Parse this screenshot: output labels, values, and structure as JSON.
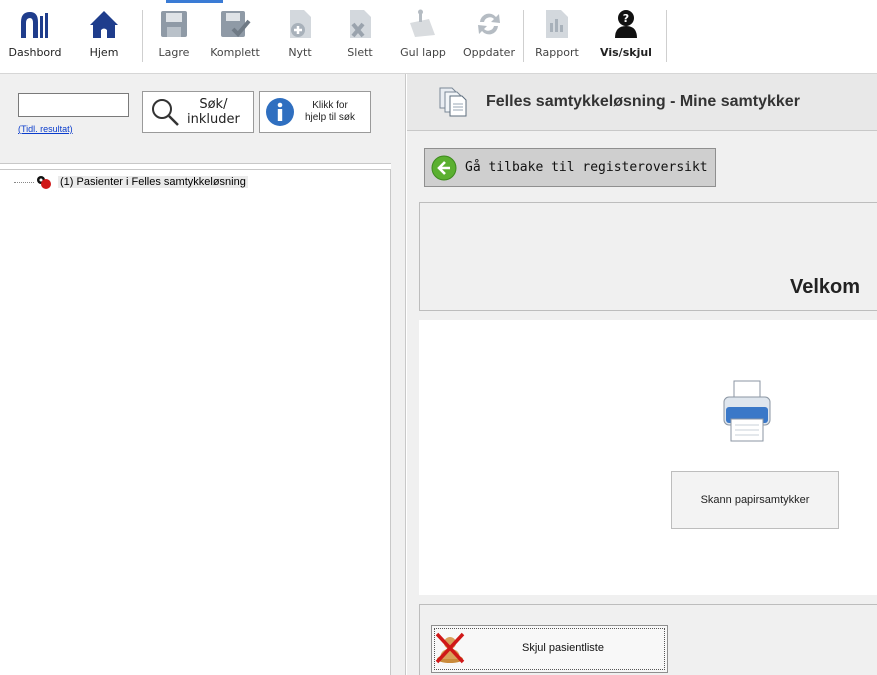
{
  "toolbar": {
    "buttons": [
      {
        "label": "Dashbord",
        "icon": "dashboard-icon",
        "enabled": true
      },
      {
        "label": "Hjem",
        "icon": "home-icon",
        "enabled": true
      },
      {
        "label": "Lagre",
        "icon": "save-icon",
        "enabled": false
      },
      {
        "label": "Komplett",
        "icon": "complete-icon",
        "enabled": false
      },
      {
        "label": "Nytt",
        "icon": "new-document-icon",
        "enabled": false
      },
      {
        "label": "Slett",
        "icon": "delete-document-icon",
        "enabled": false
      },
      {
        "label": "Gul lapp",
        "icon": "sticky-note-icon",
        "enabled": false
      },
      {
        "label": "Oppdater",
        "icon": "refresh-icon",
        "enabled": false
      },
      {
        "label": "Rapport",
        "icon": "report-icon",
        "enabled": false
      },
      {
        "label": "Vis/skjul",
        "icon": "user-silhouette-icon",
        "enabled": true
      }
    ]
  },
  "search": {
    "input_value": "",
    "previous_results_link": "(Tidl. resultat)",
    "search_button_line1": "Søk/",
    "search_button_line2": "inkluder",
    "help_button_line1": "Klikk for",
    "help_button_line2": "hjelp til søk"
  },
  "tree": {
    "items": [
      {
        "label": "(1) Pasienter i Felles samtykkeløsning",
        "icon": "patients-icon"
      }
    ]
  },
  "main": {
    "header_title": "Felles samtykkeløsning - Mine samtykker",
    "back_button_label": "Gå tilbake til registeroversikt",
    "welcome_text": "Velkom",
    "scan_button_label": "Skann papirsamtykker",
    "hide_patient_list_label": "Skjul pasientliste"
  },
  "colors": {
    "nav_icon": "#1f3d8c",
    "disabled_icon": "#9aa3ad",
    "link": "#0a3ccc",
    "back_arrow": "#5bb030"
  }
}
